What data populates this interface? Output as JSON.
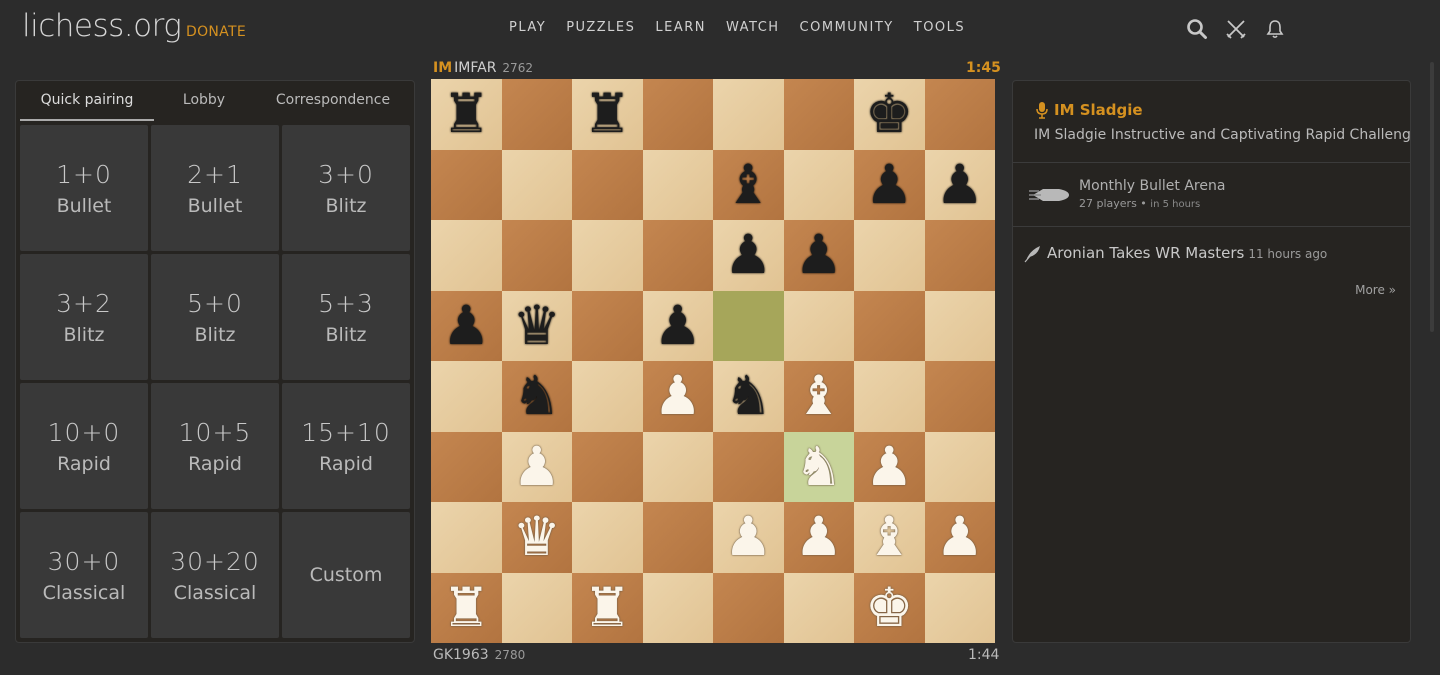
{
  "header": {
    "logo": "lichess.org",
    "donate": "DONATE",
    "nav": [
      "PLAY",
      "PUZZLES",
      "LEARN",
      "WATCH",
      "COMMUNITY",
      "TOOLS"
    ],
    "icons": [
      "search-icon",
      "swords-icon",
      "bell-icon"
    ]
  },
  "lobby": {
    "tabs": [
      "Quick pairing",
      "Lobby",
      "Correspondence"
    ],
    "active_tab": "Quick pairing",
    "pools": [
      {
        "time": "1+0",
        "perf": "Bullet"
      },
      {
        "time": "2+1",
        "perf": "Bullet"
      },
      {
        "time": "3+0",
        "perf": "Blitz"
      },
      {
        "time": "3+2",
        "perf": "Blitz"
      },
      {
        "time": "5+0",
        "perf": "Blitz"
      },
      {
        "time": "5+3",
        "perf": "Blitz"
      },
      {
        "time": "10+0",
        "perf": "Rapid"
      },
      {
        "time": "10+5",
        "perf": "Rapid"
      },
      {
        "time": "15+10",
        "perf": "Rapid"
      },
      {
        "time": "30+0",
        "perf": "Classical"
      },
      {
        "time": "30+20",
        "perf": "Classical"
      }
    ],
    "custom": "Custom"
  },
  "game": {
    "top": {
      "title": "IM",
      "name": "IMFAR",
      "rating": "2762",
      "clock": "1:45"
    },
    "bottom": {
      "name": "GK1963",
      "rating": "2780",
      "clock": "1:44"
    },
    "highlight_squares": [
      "e5",
      "f3"
    ],
    "board": [
      [
        "br",
        "",
        "br",
        "",
        "",
        "",
        "bk",
        ""
      ],
      [
        "",
        "",
        "",
        "",
        "bb",
        "",
        "bp",
        "bp"
      ],
      [
        "",
        "",
        "",
        "",
        "bp",
        "bp",
        "",
        ""
      ],
      [
        "bp",
        "bq",
        "",
        "bp",
        "",
        "",
        "",
        ""
      ],
      [
        "",
        "bn",
        "",
        "wp",
        "bn",
        "wb",
        "",
        ""
      ],
      [
        "",
        "wp",
        "",
        "",
        "",
        "wn",
        "wp",
        ""
      ],
      [
        "",
        "wq",
        "",
        "",
        "wp",
        "wp",
        "wb",
        "wp"
      ],
      [
        "wr",
        "",
        "wr",
        "",
        "",
        "",
        "wk",
        ""
      ]
    ]
  },
  "side": {
    "stream": {
      "name": "IM Sladgie",
      "desc": "IM Sladgie Instructive and Captivating Rapid Challenges w/vie"
    },
    "tournament": {
      "name": "Monthly Bullet Arena",
      "players": "27 players",
      "starts": "in 5 hours"
    },
    "blog": {
      "title": "Aronian Takes WR Masters",
      "time": "11 hours ago"
    },
    "more": "More »"
  },
  "colors": {
    "accent": "#d59120",
    "background": "#2c2c2c",
    "panel": "#262421",
    "light_square": "#e8cfa3",
    "dark_square": "#bc7f47"
  }
}
